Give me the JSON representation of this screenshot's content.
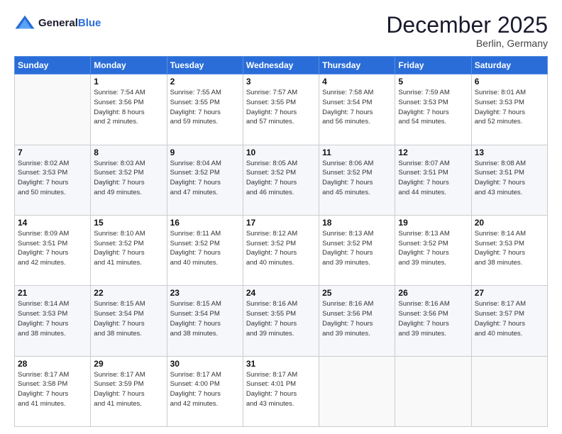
{
  "logo": {
    "line1": "General",
    "line2": "Blue"
  },
  "header": {
    "month": "December 2025",
    "location": "Berlin, Germany"
  },
  "weekdays": [
    "Sunday",
    "Monday",
    "Tuesday",
    "Wednesday",
    "Thursday",
    "Friday",
    "Saturday"
  ],
  "weeks": [
    [
      {
        "day": "",
        "info": ""
      },
      {
        "day": "1",
        "info": "Sunrise: 7:54 AM\nSunset: 3:56 PM\nDaylight: 8 hours\nand 2 minutes."
      },
      {
        "day": "2",
        "info": "Sunrise: 7:55 AM\nSunset: 3:55 PM\nDaylight: 7 hours\nand 59 minutes."
      },
      {
        "day": "3",
        "info": "Sunrise: 7:57 AM\nSunset: 3:55 PM\nDaylight: 7 hours\nand 57 minutes."
      },
      {
        "day": "4",
        "info": "Sunrise: 7:58 AM\nSunset: 3:54 PM\nDaylight: 7 hours\nand 56 minutes."
      },
      {
        "day": "5",
        "info": "Sunrise: 7:59 AM\nSunset: 3:53 PM\nDaylight: 7 hours\nand 54 minutes."
      },
      {
        "day": "6",
        "info": "Sunrise: 8:01 AM\nSunset: 3:53 PM\nDaylight: 7 hours\nand 52 minutes."
      }
    ],
    [
      {
        "day": "7",
        "info": "Sunrise: 8:02 AM\nSunset: 3:53 PM\nDaylight: 7 hours\nand 50 minutes."
      },
      {
        "day": "8",
        "info": "Sunrise: 8:03 AM\nSunset: 3:52 PM\nDaylight: 7 hours\nand 49 minutes."
      },
      {
        "day": "9",
        "info": "Sunrise: 8:04 AM\nSunset: 3:52 PM\nDaylight: 7 hours\nand 47 minutes."
      },
      {
        "day": "10",
        "info": "Sunrise: 8:05 AM\nSunset: 3:52 PM\nDaylight: 7 hours\nand 46 minutes."
      },
      {
        "day": "11",
        "info": "Sunrise: 8:06 AM\nSunset: 3:52 PM\nDaylight: 7 hours\nand 45 minutes."
      },
      {
        "day": "12",
        "info": "Sunrise: 8:07 AM\nSunset: 3:51 PM\nDaylight: 7 hours\nand 44 minutes."
      },
      {
        "day": "13",
        "info": "Sunrise: 8:08 AM\nSunset: 3:51 PM\nDaylight: 7 hours\nand 43 minutes."
      }
    ],
    [
      {
        "day": "14",
        "info": "Sunrise: 8:09 AM\nSunset: 3:51 PM\nDaylight: 7 hours\nand 42 minutes."
      },
      {
        "day": "15",
        "info": "Sunrise: 8:10 AM\nSunset: 3:52 PM\nDaylight: 7 hours\nand 41 minutes."
      },
      {
        "day": "16",
        "info": "Sunrise: 8:11 AM\nSunset: 3:52 PM\nDaylight: 7 hours\nand 40 minutes."
      },
      {
        "day": "17",
        "info": "Sunrise: 8:12 AM\nSunset: 3:52 PM\nDaylight: 7 hours\nand 40 minutes."
      },
      {
        "day": "18",
        "info": "Sunrise: 8:13 AM\nSunset: 3:52 PM\nDaylight: 7 hours\nand 39 minutes."
      },
      {
        "day": "19",
        "info": "Sunrise: 8:13 AM\nSunset: 3:52 PM\nDaylight: 7 hours\nand 39 minutes."
      },
      {
        "day": "20",
        "info": "Sunrise: 8:14 AM\nSunset: 3:53 PM\nDaylight: 7 hours\nand 38 minutes."
      }
    ],
    [
      {
        "day": "21",
        "info": "Sunrise: 8:14 AM\nSunset: 3:53 PM\nDaylight: 7 hours\nand 38 minutes."
      },
      {
        "day": "22",
        "info": "Sunrise: 8:15 AM\nSunset: 3:54 PM\nDaylight: 7 hours\nand 38 minutes."
      },
      {
        "day": "23",
        "info": "Sunrise: 8:15 AM\nSunset: 3:54 PM\nDaylight: 7 hours\nand 38 minutes."
      },
      {
        "day": "24",
        "info": "Sunrise: 8:16 AM\nSunset: 3:55 PM\nDaylight: 7 hours\nand 39 minutes."
      },
      {
        "day": "25",
        "info": "Sunrise: 8:16 AM\nSunset: 3:56 PM\nDaylight: 7 hours\nand 39 minutes."
      },
      {
        "day": "26",
        "info": "Sunrise: 8:16 AM\nSunset: 3:56 PM\nDaylight: 7 hours\nand 39 minutes."
      },
      {
        "day": "27",
        "info": "Sunrise: 8:17 AM\nSunset: 3:57 PM\nDaylight: 7 hours\nand 40 minutes."
      }
    ],
    [
      {
        "day": "28",
        "info": "Sunrise: 8:17 AM\nSunset: 3:58 PM\nDaylight: 7 hours\nand 41 minutes."
      },
      {
        "day": "29",
        "info": "Sunrise: 8:17 AM\nSunset: 3:59 PM\nDaylight: 7 hours\nand 41 minutes."
      },
      {
        "day": "30",
        "info": "Sunrise: 8:17 AM\nSunset: 4:00 PM\nDaylight: 7 hours\nand 42 minutes."
      },
      {
        "day": "31",
        "info": "Sunrise: 8:17 AM\nSunset: 4:01 PM\nDaylight: 7 hours\nand 43 minutes."
      },
      {
        "day": "",
        "info": ""
      },
      {
        "day": "",
        "info": ""
      },
      {
        "day": "",
        "info": ""
      }
    ]
  ]
}
